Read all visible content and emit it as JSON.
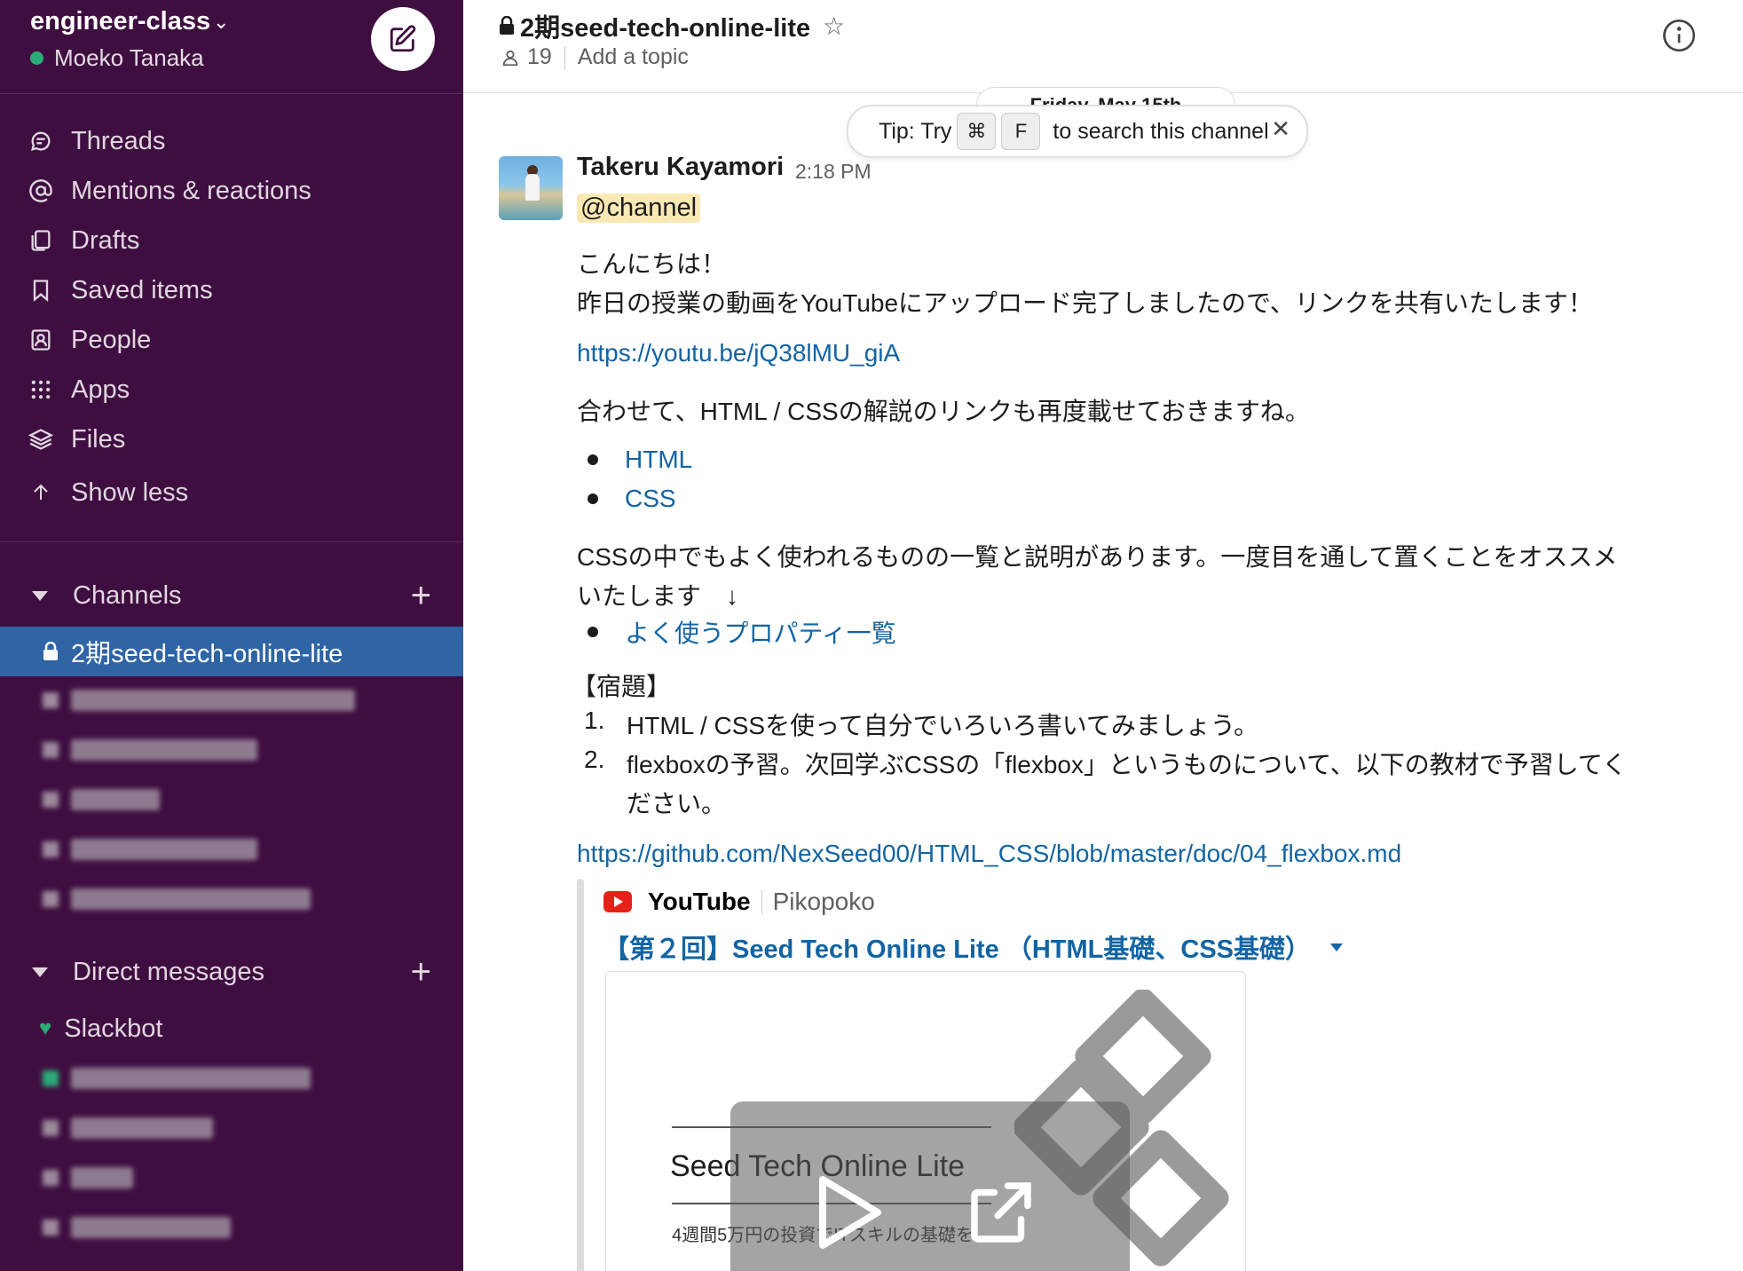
{
  "workspace": {
    "name": "engineer-class",
    "user": "Moeko Tanaka"
  },
  "nav": {
    "threads": "Threads",
    "mentions": "Mentions & reactions",
    "drafts": "Drafts",
    "saved": "Saved items",
    "people": "People",
    "apps": "Apps",
    "files": "Files",
    "show_less": "Show less"
  },
  "channels": {
    "header": "Channels",
    "active": "2期seed-tech-online-lite"
  },
  "dms": {
    "header": "Direct messages",
    "slackbot": "Slackbot"
  },
  "channel_header": {
    "title": "2期seed-tech-online-lite",
    "members": "19",
    "topic_placeholder": "Add a topic"
  },
  "date_divider": "Friday, May 15th",
  "tip": {
    "prefix": "Tip: Try",
    "key1": "⌘",
    "key2": "F",
    "suffix": "to search this channel"
  },
  "message": {
    "author": "Takeru Kayamori",
    "time": "2:18 PM",
    "mention": "@channel",
    "greeting": "こんにちは！",
    "line1": "昨日の授業の動画をYouTubeにアップロード完了しましたので、リンクを共有いたします！",
    "youtube_link": "https://youtu.be/jQ38lMU_giA",
    "line2": "合わせて、HTML / CSSの解説のリンクも再度載せておきますね。",
    "bullets": [
      "HTML",
      "CSS"
    ],
    "line3a": "CSSの中でもよく使われるものの一覧と説明があります。一度目を通して置くことをオススメ",
    "line3b": "いたします　↓",
    "bullet3": "よく使うプロパティ一覧",
    "homework_title": "【宿題】",
    "homework": [
      {
        "num": "1.",
        "text": "HTML / CSSを使って自分でいろいろ書いてみましょう。"
      },
      {
        "num": "2.",
        "text": "flexboxの予習。次回学ぶCSSの「flexbox」というものについて、以下の教材で予習してく"
      }
    ],
    "homework2_cont": "ださい。",
    "github_link": "https://github.com/NexSeed00/HTML_CSS/blob/master/doc/04_flexbox.md"
  },
  "attachment": {
    "service": "YouTube",
    "channel": "Pikopoko",
    "title": "【第２回】Seed Tech Online Lite （HTML基礎、CSS基礎）",
    "thumb_title": "Seed Tech Online Lite",
    "thumb_sub": "4週間5万円の投資でITスキルの基礎を"
  }
}
